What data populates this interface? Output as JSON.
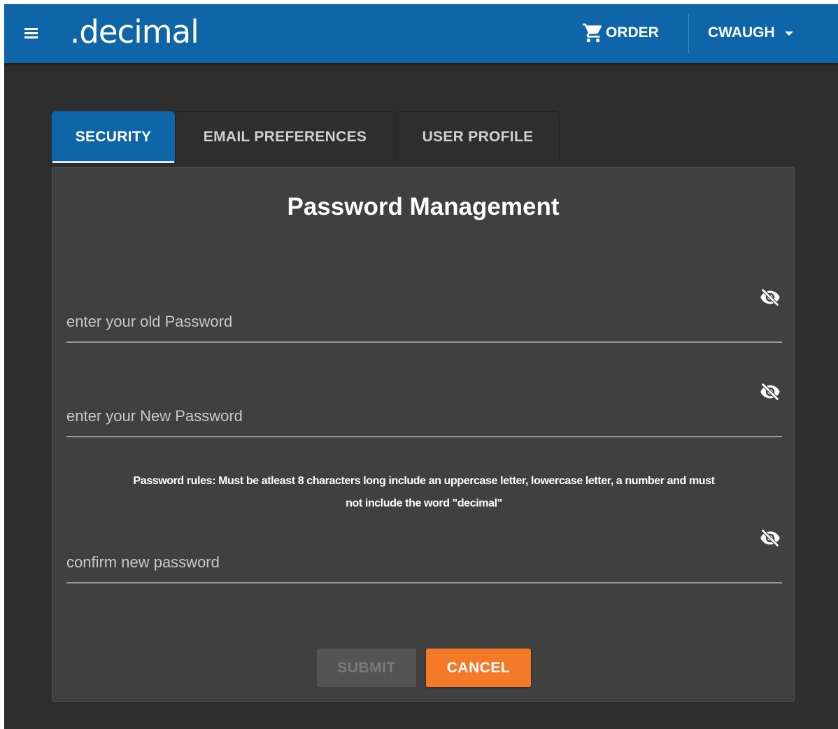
{
  "header": {
    "brand": ".decimal",
    "order_label": "ORDER",
    "user_label": "CWAUGH",
    "brand_color": "#0e65a8"
  },
  "tabs": [
    {
      "label": "SECURITY",
      "active": true
    },
    {
      "label": "EMAIL PREFERENCES",
      "active": false
    },
    {
      "label": "USER PROFILE",
      "active": false
    }
  ],
  "panel": {
    "title": "Password Management",
    "fields": [
      {
        "placeholder": "enter your old Password",
        "icon": "eye-off-icon"
      },
      {
        "placeholder": "enter your New Password",
        "icon": "eye-off-icon"
      },
      {
        "placeholder": "confirm new password",
        "icon": "eye-off-icon"
      }
    ],
    "rules_line1": "Password rules: Must be atleast 8 characters long include an uppercase letter, lowercase letter, a number and must",
    "rules_line2": "not include the word \"decimal\""
  },
  "actions": {
    "submit_label": "SUBMIT",
    "cancel_label": "CANCEL",
    "cancel_color": "#f47a27"
  }
}
